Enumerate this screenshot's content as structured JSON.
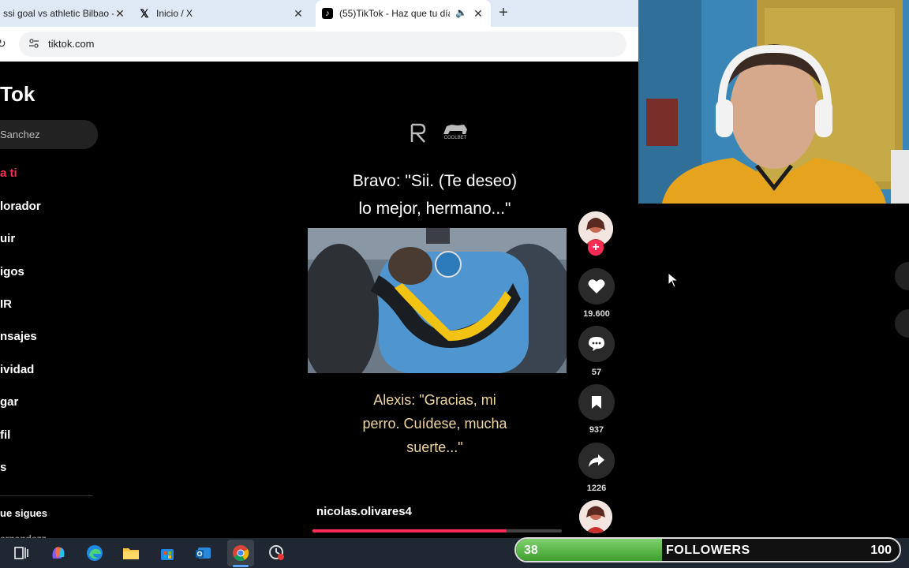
{
  "browser": {
    "tabs": [
      {
        "title": "ssi goal vs athletic Bilbao - V",
        "icon": "generic-icon",
        "active": false
      },
      {
        "title": "Inicio / X",
        "icon": "x-logo-icon",
        "active": false
      },
      {
        "title": "(55)TikTok - Haz que tu día",
        "icon": "tiktok-icon",
        "active": true
      }
    ],
    "address": "tiktok.com"
  },
  "tiktok": {
    "logo": "Tok",
    "search_value": "Sanchez",
    "nav": [
      {
        "label": "a ti",
        "active": true
      },
      {
        "label": "lorador"
      },
      {
        "label": "uir"
      },
      {
        "label": "igos"
      },
      {
        "label": "IR"
      },
      {
        "label": "nsajes"
      },
      {
        "label": "ividad"
      },
      {
        "label": "gar"
      },
      {
        "label": "fil"
      },
      {
        "label": "s"
      }
    ],
    "following_section": "ue sigues",
    "following_partial": "ernandezz"
  },
  "video": {
    "caption_top_line1": "Bravo: \"Sii. (Te deseo)",
    "caption_top_line2": "lo mejor, hermano...\"",
    "caption_bottom_line1": "Alexis: \"Gracias, mi",
    "caption_bottom_line2": "perro. Cuídese, mucha",
    "caption_bottom_line3": "suerte...\"",
    "author": "nicolas.olivares4",
    "progress": 0.78,
    "logos": [
      "Rb-logo-icon",
      "coolbet-logo-icon"
    ],
    "coolbet_text": "COOLBET"
  },
  "actions": {
    "likes": "19.600",
    "comments": "57",
    "saves": "937",
    "shares": "1226"
  },
  "overlay": {
    "current": "38",
    "label": "FOLLOWERS",
    "goal": "100",
    "progress": 0.38
  },
  "colors": {
    "accent": "#fe2c55",
    "followers_green": "#5cbf4a"
  }
}
